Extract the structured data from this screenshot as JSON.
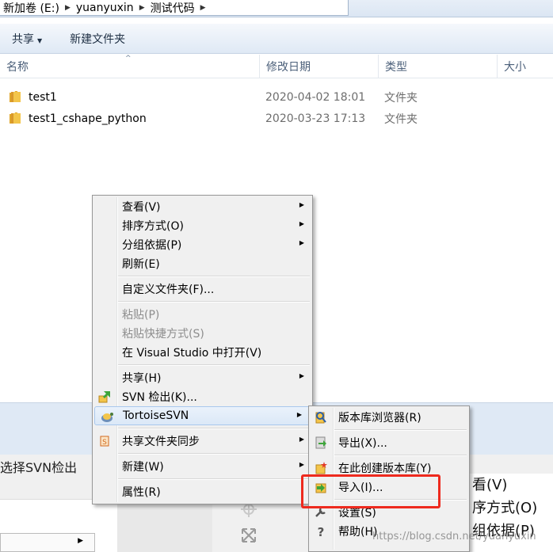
{
  "address_bar": {
    "crumbs": [
      "新加卷 (E:)",
      "yuanyuxin",
      "测试代码"
    ]
  },
  "toolbar": {
    "share_label": "共享",
    "new_folder_label": "新建文件夹"
  },
  "columns": {
    "name": "名称",
    "date": "修改日期",
    "type": "类型",
    "size": "大小"
  },
  "files": [
    {
      "name": "test1",
      "date": "2020-04-02 18:01",
      "type": "文件夹"
    },
    {
      "name": "test1_cshape_python",
      "date": "2020-03-23 17:13",
      "type": "文件夹"
    }
  ],
  "context_menu": {
    "view": "查看(V)",
    "sort_by": "排序方式(O)",
    "group_by": "分组依据(P)",
    "refresh": "刷新(E)",
    "customize_folder": "自定义文件夹(F)...",
    "paste": "粘贴(P)",
    "paste_shortcut": "粘贴快捷方式(S)",
    "open_in_vs": "在 Visual Studio 中打开(V)",
    "share": "共享(H)",
    "svn_checkout": "SVN 检出(K)...",
    "tortoisesvn": "TortoiseSVN",
    "sync_shared": "共享文件夹同步",
    "new": "新建(W)",
    "properties": "属性(R)"
  },
  "svn_submenu": {
    "repo_browser": "版本库浏览器(R)",
    "export": "导出(X)...",
    "create_repo": "在此创建版本库(Y)",
    "import": "导入(I)...",
    "settings": "设置(S)",
    "help": "帮助(H)"
  },
  "background": {
    "label": "选择SVN检出",
    "menu_items": [
      "看(V)",
      "序方式(O)",
      "组依据(P)"
    ],
    "watermark": "https://blog.csdn.net/yuanyuxin"
  },
  "colors": {
    "highlight_border": "#ee2a1e",
    "menu_bg": "#f0f0f0",
    "folder_yellow": "#f3c54a"
  }
}
